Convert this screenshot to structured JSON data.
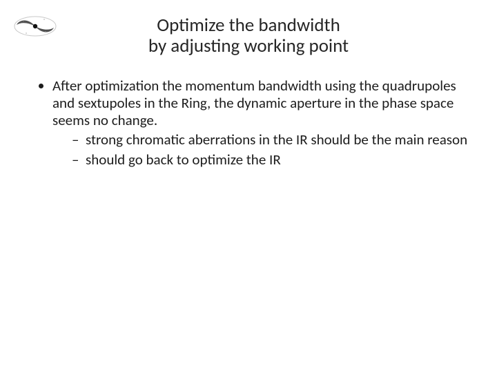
{
  "title": {
    "line1": "Optimize the bandwidth",
    "line2": "by adjusting working point"
  },
  "body": {
    "bullet1": "After optimization the momentum bandwidth using the quadrupoles and sextupoles in the Ring, the dynamic aperture in the phase space seems no change.",
    "sub1": "strong chromatic aberrations in the IR should be the main reason",
    "sub2": "should go back to optimize the IR"
  }
}
